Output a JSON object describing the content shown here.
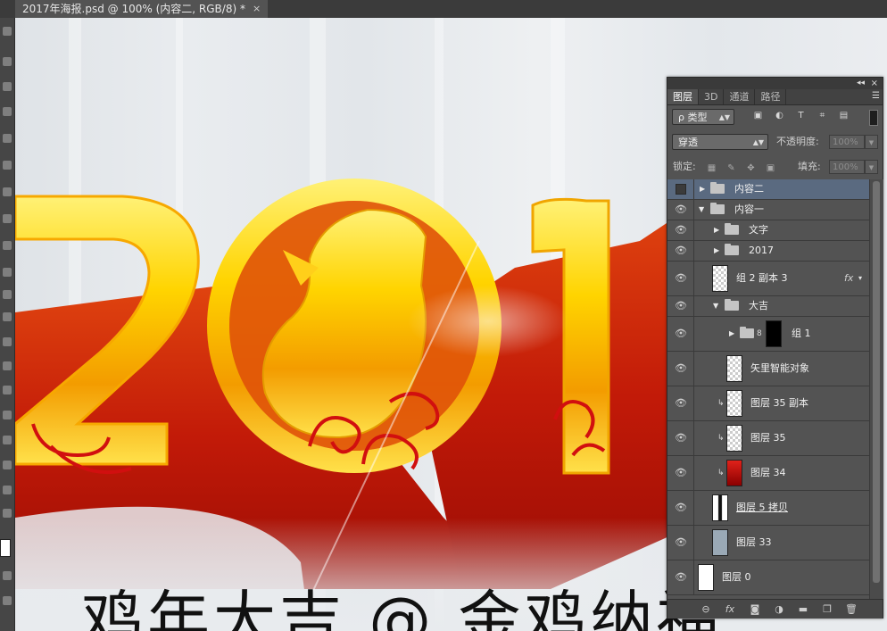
{
  "document_tab": {
    "title": "2017年海报.psd @ 100% (内容二, RGB/8) *",
    "close": "×"
  },
  "canvas": {
    "headline": "鸡年大吉 @ 金鸡纳福"
  },
  "layers_panel": {
    "collapse_icon": "◂◂",
    "close_icon": "×",
    "tabs": [
      {
        "label": "图层",
        "active": true
      },
      {
        "label": "3D"
      },
      {
        "label": "通道"
      },
      {
        "label": "路径"
      }
    ],
    "filter": {
      "label": "ρ 类型"
    },
    "blend_mode": "穿透",
    "opacity_label": "不透明度:",
    "opacity_value": "100%",
    "lock_label": "锁定:",
    "fill_label": "填充:",
    "fill_value": "100%",
    "layers": [
      {
        "name": "内容二",
        "type": "group",
        "visible": false,
        "expanded": false,
        "selected": true,
        "indent": 0
      },
      {
        "name": "内容一",
        "type": "group",
        "visible": true,
        "expanded": true,
        "indent": 0
      },
      {
        "name": "文字",
        "type": "group",
        "visible": true,
        "expanded": false,
        "indent": 1
      },
      {
        "name": "2017",
        "type": "group",
        "visible": true,
        "expanded": false,
        "indent": 1
      },
      {
        "name": "组 2 副本 3",
        "type": "layer",
        "visible": true,
        "fx": "fx",
        "indent": 1
      },
      {
        "name": "大吉",
        "type": "group",
        "visible": true,
        "expanded": true,
        "indent": 1
      },
      {
        "name": "组 1",
        "type": "group-masked",
        "visible": true,
        "expanded": false,
        "indent": 2
      },
      {
        "name": "矢里智能对象",
        "type": "smart",
        "visible": true,
        "indent": 2
      },
      {
        "name": "图层 35 副本",
        "type": "layer",
        "visible": true,
        "clipped": true,
        "indent": 2
      },
      {
        "name": "图层 35",
        "type": "layer",
        "visible": true,
        "clipped": true,
        "indent": 2
      },
      {
        "name": "图层 34",
        "type": "layer-red",
        "visible": true,
        "clipped": true,
        "indent": 2
      },
      {
        "name": "图层 5 拷贝",
        "type": "layer-black",
        "visible": true,
        "indent": 1
      },
      {
        "name": "图层 33",
        "type": "layer-blue",
        "visible": true,
        "indent": 1
      },
      {
        "name": "图层 0",
        "type": "layer-white",
        "visible": true,
        "indent": 0
      }
    ],
    "bottom_icons": [
      "link-icon",
      "fx-icon",
      "mask-icon",
      "adjustment-icon",
      "folder-icon",
      "new-layer-icon",
      "trash-icon"
    ]
  },
  "colors": {
    "gold": "#f5c400",
    "red": "#c8180a",
    "panel": "#535353",
    "selected": "#5a6a80"
  }
}
